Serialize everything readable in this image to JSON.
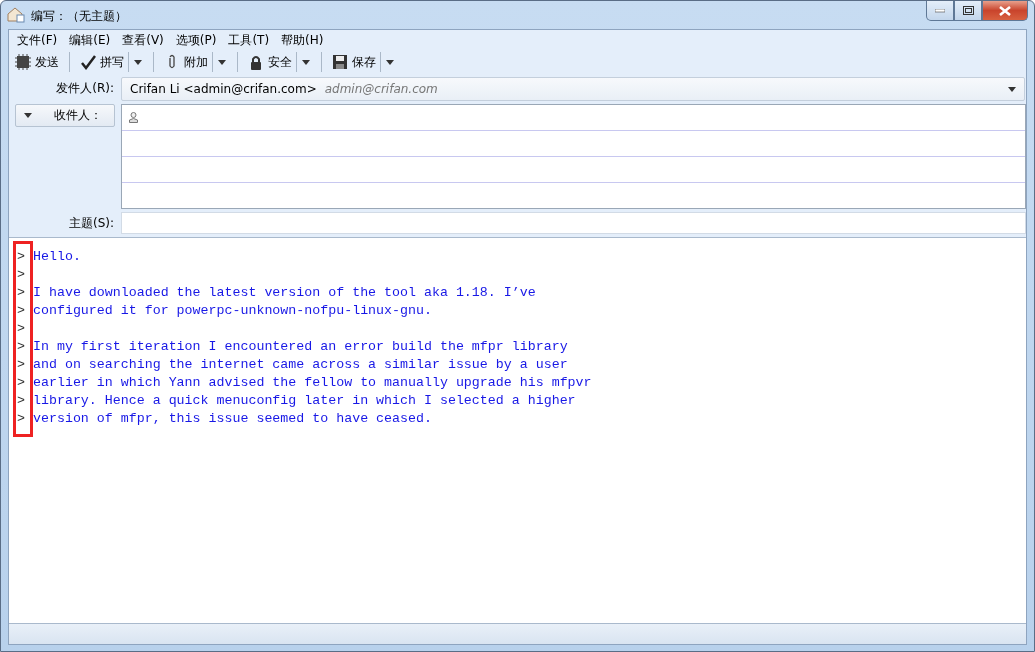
{
  "window": {
    "title": "编写：（无主题）"
  },
  "menu": [
    "文件(F)",
    "编辑(E)",
    "查看(V)",
    "选项(P)",
    "工具(T)",
    "帮助(H)"
  ],
  "toolbar": [
    {
      "label": "发送",
      "kind": "send",
      "dropdown": false
    },
    {
      "label": "拼写",
      "kind": "spell",
      "dropdown": true
    },
    {
      "label": "附加",
      "kind": "attach",
      "dropdown": true
    },
    {
      "label": "安全",
      "kind": "security",
      "dropdown": true
    },
    {
      "label": "保存",
      "kind": "save",
      "dropdown": true
    }
  ],
  "from": {
    "label": "发件人(R):",
    "value": "Crifan Li <admin@crifan.com>",
    "hint": "admin@crifan.com"
  },
  "to": {
    "label": "收件人："
  },
  "subject": {
    "label": "主题(S):"
  },
  "body": [
    {
      "marker": ">",
      "text": "Hello."
    },
    {
      "marker": ">"
    },
    {
      "marker": ">",
      "text": "I have downloaded the latest version of the tool aka 1.18. I’ve"
    },
    {
      "marker": ">",
      "text": "configured it for powerpc-unknown-nofpu-linux-gnu."
    },
    {
      "marker": ">"
    },
    {
      "marker": ">",
      "text": "In my first iteration I encountered an error build the mfpr library"
    },
    {
      "marker": ">",
      "text": "and on searching the internet came across a similar issue by a user"
    },
    {
      "marker": ">",
      "text": "earlier in which Yann advised the fellow to manually upgrade his mfpvr"
    },
    {
      "marker": ">",
      "text": "library. Hence a quick menuconfig later in which I selected a higher"
    },
    {
      "marker": ">",
      "text": "version of mfpr, this issue seemed to have ceased."
    }
  ]
}
